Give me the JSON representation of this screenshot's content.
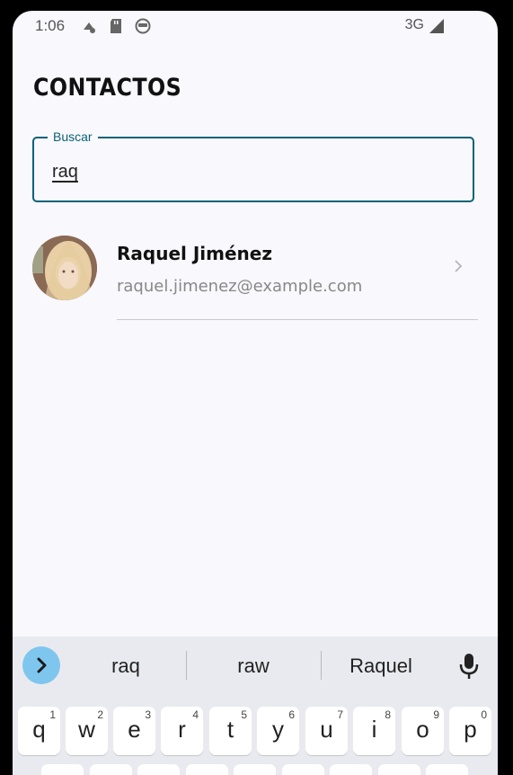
{
  "status_bar": {
    "time": "1:06",
    "network": "3G",
    "icons": [
      "wifi-off-icon",
      "sd-card-icon",
      "android-icon",
      "signal-icon"
    ]
  },
  "header": {
    "title": "CONTACTOS"
  },
  "search": {
    "label": "Buscar",
    "value": "raq"
  },
  "contacts": [
    {
      "name": "Raquel Jiménez",
      "email": "raquel.jimenez@example.com"
    }
  ],
  "keyboard": {
    "suggestions": [
      "raq",
      "raw",
      "Raquel"
    ],
    "row1": [
      {
        "letter": "q",
        "num": "1"
      },
      {
        "letter": "w",
        "num": "2"
      },
      {
        "letter": "e",
        "num": "3"
      },
      {
        "letter": "r",
        "num": "4"
      },
      {
        "letter": "t",
        "num": "5"
      },
      {
        "letter": "y",
        "num": "6"
      },
      {
        "letter": "u",
        "num": "7"
      },
      {
        "letter": "i",
        "num": "8"
      },
      {
        "letter": "o",
        "num": "9"
      },
      {
        "letter": "p",
        "num": "0"
      }
    ]
  },
  "colors": {
    "accent": "#0c6277",
    "kb_expand": "#7ec6ee",
    "background": "#f8f8fd"
  }
}
